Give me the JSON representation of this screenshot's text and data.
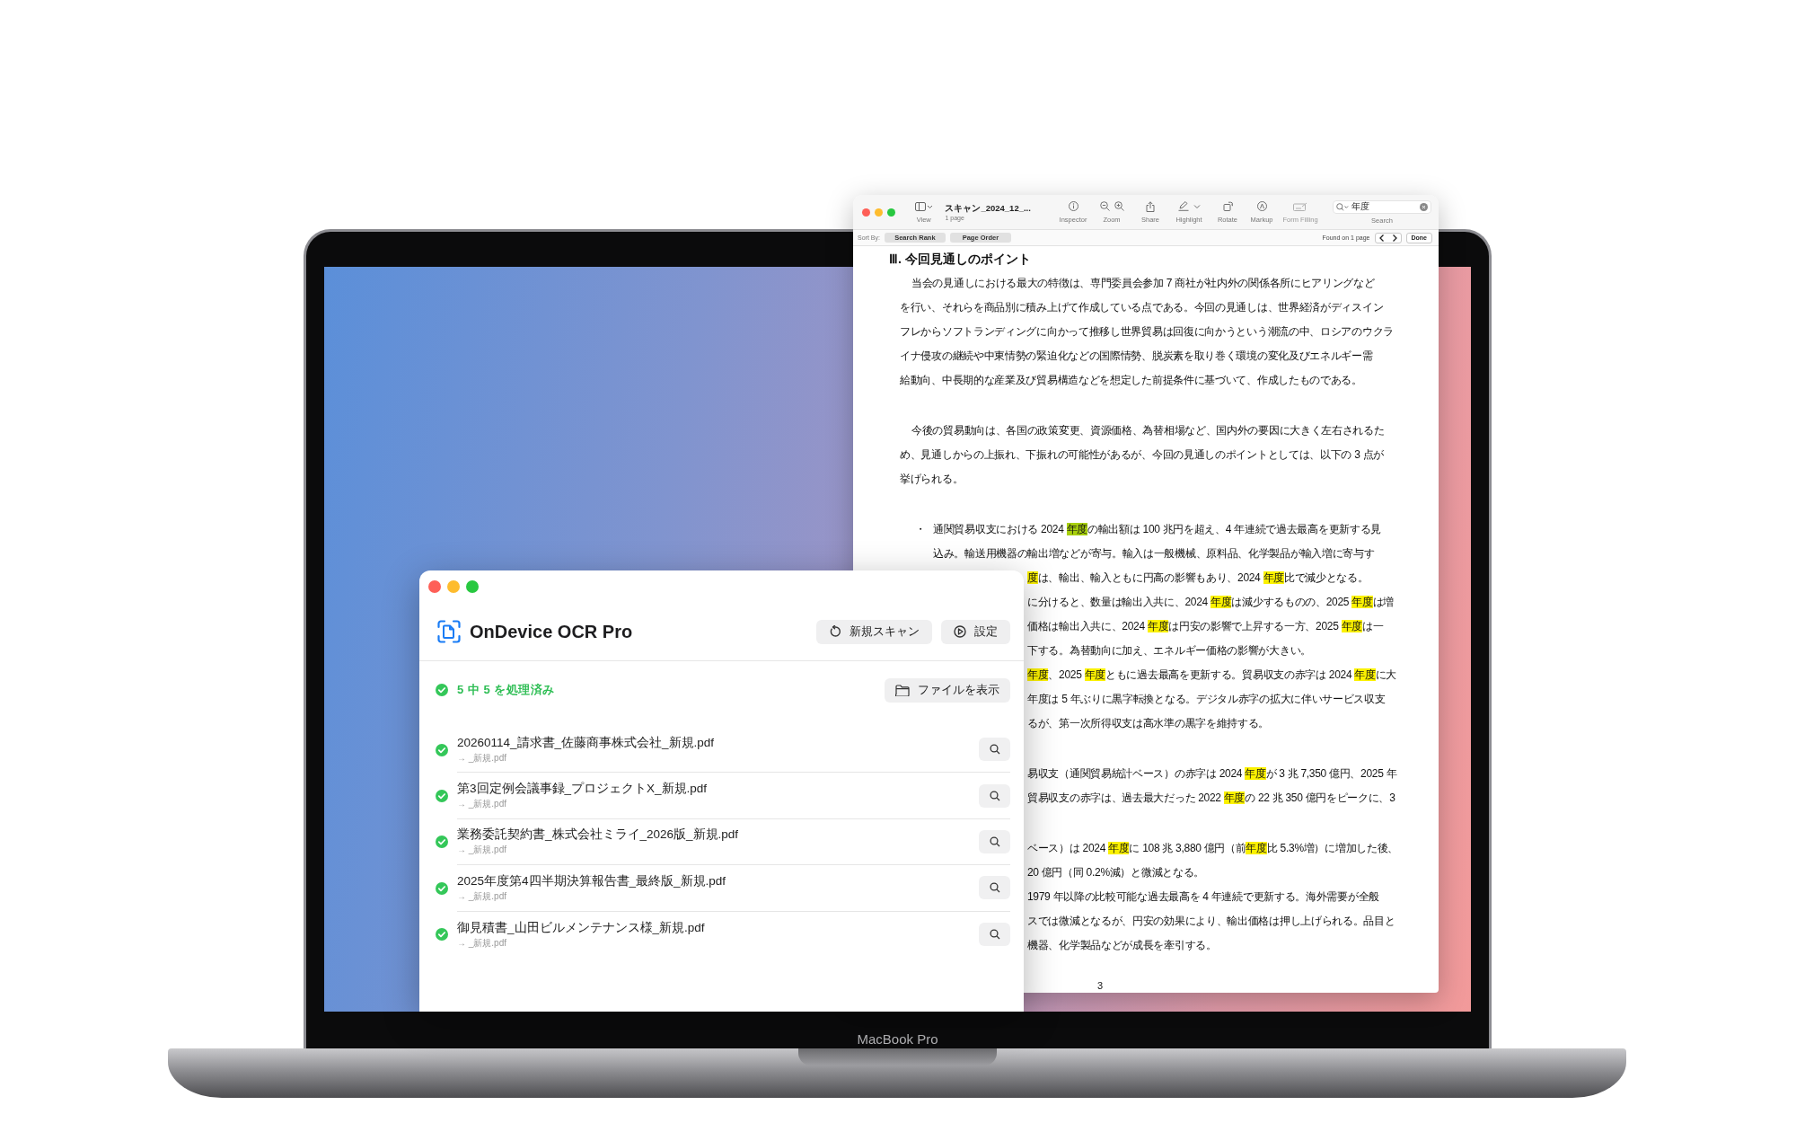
{
  "laptop": {
    "model": "MacBook Pro"
  },
  "preview": {
    "title": "スキャン_2024_12_...",
    "subtitle": "1 page",
    "view_label": "View",
    "toolbar": [
      {
        "kind": "inspector",
        "label": "Inspector",
        "disabled": false
      },
      {
        "kind": "zoom",
        "label": "Zoom",
        "disabled": false
      },
      {
        "kind": "share",
        "label": "Share",
        "disabled": false
      },
      {
        "kind": "highlight",
        "label": "Highlight",
        "disabled": false
      },
      {
        "kind": "rotate",
        "label": "Rotate",
        "disabled": false
      },
      {
        "kind": "markup",
        "label": "Markup",
        "disabled": false
      },
      {
        "kind": "form",
        "label": "Form Filling",
        "disabled": true
      }
    ],
    "search": {
      "value": "年度",
      "label": "Search"
    },
    "sort_label": "Sort By:",
    "sort_options": [
      "Search Rank",
      "Page Order"
    ],
    "found": "Found on 1 page",
    "done": "Done",
    "document": {
      "heading": "Ⅲ. 今回見通しのポイント",
      "page_number": "3",
      "blocks": [
        {
          "kind": "para",
          "lines": [
            {
              "kind": "indent",
              "segs": [
                {
                  "kind": "plain",
                  "text": "当会の見通しにおける最大の特徴は、専門委員会参加 7 商社が社内外の関係各所にヒアリングなど"
                }
              ]
            },
            {
              "kind": "full",
              "segs": [
                {
                  "kind": "plain",
                  "text": "を行い、それらを商品別に積み上げて作成している点である。今回の見通しは、世界経済がディスイン"
                }
              ]
            },
            {
              "kind": "full",
              "segs": [
                {
                  "kind": "plain",
                  "text": "フレからソフトランディングに向かって推移し世界貿易は回復に向かうという潮流の中、ロシアのウクラ"
                }
              ]
            },
            {
              "kind": "full",
              "segs": [
                {
                  "kind": "plain",
                  "text": "イナ侵攻の継続や中東情勢の緊迫化などの国際情勢、脱炭素を取り巻く環境の変化及びエネルギー需"
                }
              ]
            },
            {
              "kind": "full",
              "segs": [
                {
                  "kind": "plain",
                  "text": "給動向、中長期的な産業及び貿易構造などを想定した前提条件に基づいて、作成したものである。"
                }
              ]
            }
          ]
        },
        {
          "kind": "para",
          "lines": [
            {
              "kind": "indent",
              "segs": [
                {
                  "kind": "plain",
                  "text": "今後の貿易動向は、各国の政策変更、資源価格、為替相場など、国内外の要因に大きく左右されるた"
                }
              ]
            },
            {
              "kind": "full",
              "segs": [
                {
                  "kind": "plain",
                  "text": "め、見通しからの上振れ、下振れの可能性があるが、今回の見通しのポイントとしては、以下の 3 点が"
                }
              ]
            },
            {
              "kind": "full",
              "segs": [
                {
                  "kind": "plain",
                  "text": "挙げられる。"
                }
              ]
            }
          ]
        },
        {
          "kind": "bullet",
          "bullet": "・",
          "lines": [
            {
              "kind": "full",
              "segs": [
                {
                  "kind": "plain",
                  "text": "通関貿易収支における 2024 "
                },
                {
                  "kind": "current",
                  "text": "年度"
                },
                {
                  "kind": "plain",
                  "text": "の輸出額は 100 兆円を超え、4 年連続で過去最高を更新する見"
                }
              ]
            },
            {
              "kind": "full",
              "segs": [
                {
                  "kind": "plain",
                  "text": "込み。輸送用機器の輸出増などが寄与。輸入は一般機械、原料品、化学製品が輸入増に寄与す"
                }
              ]
            },
            {
              "kind": "clipped",
              "segs": [
                {
                  "kind": "match",
                  "text": "度"
                },
                {
                  "kind": "plain",
                  "text": "は、輸出、輸入ともに円高の影響もあり、2024 "
                },
                {
                  "kind": "match",
                  "text": "年度"
                },
                {
                  "kind": "plain",
                  "text": "比で減少となる。"
                }
              ]
            },
            {
              "kind": "clipped",
              "segs": [
                {
                  "kind": "plain",
                  "text": "に分けると、数量は輸出入共に、2024 "
                },
                {
                  "kind": "match",
                  "text": "年度"
                },
                {
                  "kind": "plain",
                  "text": "は減少するものの、2025 "
                },
                {
                  "kind": "match",
                  "text": "年度"
                },
                {
                  "kind": "plain",
                  "text": "は増"
                }
              ]
            },
            {
              "kind": "clipped",
              "segs": [
                {
                  "kind": "plain",
                  "text": "価格は輸出入共に、2024 "
                },
                {
                  "kind": "match",
                  "text": "年度"
                },
                {
                  "kind": "plain",
                  "text": "は円安の影響で上昇する一方、2025 "
                },
                {
                  "kind": "match",
                  "text": "年度"
                },
                {
                  "kind": "plain",
                  "text": "は一"
                }
              ]
            },
            {
              "kind": "clipped",
              "segs": [
                {
                  "kind": "plain",
                  "text": "下する。為替動向に加え、エネルギー価格の影響が大きい。"
                }
              ]
            },
            {
              "kind": "clipped",
              "segs": [
                {
                  "kind": "match",
                  "text": "年度"
                },
                {
                  "kind": "plain",
                  "text": "、2025 "
                },
                {
                  "kind": "match",
                  "text": "年度"
                },
                {
                  "kind": "plain",
                  "text": "ともに過去最高を更新する。貿易収支の赤字は 2024 "
                },
                {
                  "kind": "match",
                  "text": "年度"
                },
                {
                  "kind": "plain",
                  "text": "に大"
                }
              ]
            },
            {
              "kind": "clipped",
              "segs": [
                {
                  "kind": "plain",
                  "text": "年度は 5 年ぶりに黒字転換となる。デジタル赤字の拡大に伴いサービス収支"
                }
              ]
            },
            {
              "kind": "clipped",
              "segs": [
                {
                  "kind": "plain",
                  "text": "るが、第一次所得収支は高水準の黒字を維持する。"
                }
              ]
            }
          ]
        },
        {
          "kind": "para",
          "lines": [
            {
              "kind": "clipped",
              "segs": [
                {
                  "kind": "plain",
                  "text": "易収支（通関貿易統計ベース）の赤字は 2024 "
                },
                {
                  "kind": "match",
                  "text": "年度"
                },
                {
                  "kind": "plain",
                  "text": "が 3 兆 7,350 億円、2025 年"
                }
              ]
            },
            {
              "kind": "clipped",
              "segs": [
                {
                  "kind": "plain",
                  "text": "貿易収支の赤字は、過去最大だった 2022 "
                },
                {
                  "kind": "match",
                  "text": "年度"
                },
                {
                  "kind": "plain",
                  "text": "の 22 兆 350 億円をピークに、3"
                }
              ]
            }
          ]
        },
        {
          "kind": "para",
          "lines": [
            {
              "kind": "clipped",
              "segs": [
                {
                  "kind": "plain",
                  "text": "ベース）は 2024 "
                },
                {
                  "kind": "match",
                  "text": "年度"
                },
                {
                  "kind": "plain",
                  "text": "に 108 兆 3,880 億円（前"
                },
                {
                  "kind": "match",
                  "text": "年度"
                },
                {
                  "kind": "plain",
                  "text": "比 5.3%増）に増加した後、"
                }
              ]
            },
            {
              "kind": "clipped",
              "segs": [
                {
                  "kind": "plain",
                  "text": "20 億円（同 0.2%減）と微減となる。"
                }
              ]
            },
            {
              "kind": "clipped",
              "segs": [
                {
                  "kind": "plain",
                  "text": "1979 年以降の比較可能な過去最高を 4 年連続で更新する。海外需要が全般"
                }
              ]
            },
            {
              "kind": "clipped",
              "segs": [
                {
                  "kind": "plain",
                  "text": "スでは微減となるが、円安の効果により、輸出価格は押し上げられる。品目と"
                }
              ]
            },
            {
              "kind": "clipped",
              "segs": [
                {
                  "kind": "plain",
                  "text": "機器、化学製品などが成長を牽引する。"
                }
              ]
            }
          ]
        }
      ]
    }
  },
  "app": {
    "name": "OnDevice OCR Pro",
    "buttons": [
      {
        "kind": "refresh",
        "label": "新規スキャン"
      },
      {
        "kind": "settings",
        "label": "設定"
      }
    ],
    "status": "5 中 5 を処理済み",
    "show_files": "ファイルを表示",
    "files": [
      {
        "name": "20260114_請求書_佐藤商事株式会社_新規.pdf",
        "output": "→ _新規.pdf",
        "done": true
      },
      {
        "name": "第3回定例会議事録_プロジェクトX_新規.pdf",
        "output": "→ _新規.pdf",
        "done": true
      },
      {
        "name": "業務委託契約書_株式会社ミライ_2026版_新規.pdf",
        "output": "→ _新規.pdf",
        "done": true
      },
      {
        "name": "2025年度第4四半期決算報告書_最終版_新規.pdf",
        "output": "→ _新規.pdf",
        "done": true
      },
      {
        "name": "御見積書_山田ビルメンテナンス様_新規.pdf",
        "output": "→ _新規.pdf",
        "done": true
      }
    ]
  }
}
